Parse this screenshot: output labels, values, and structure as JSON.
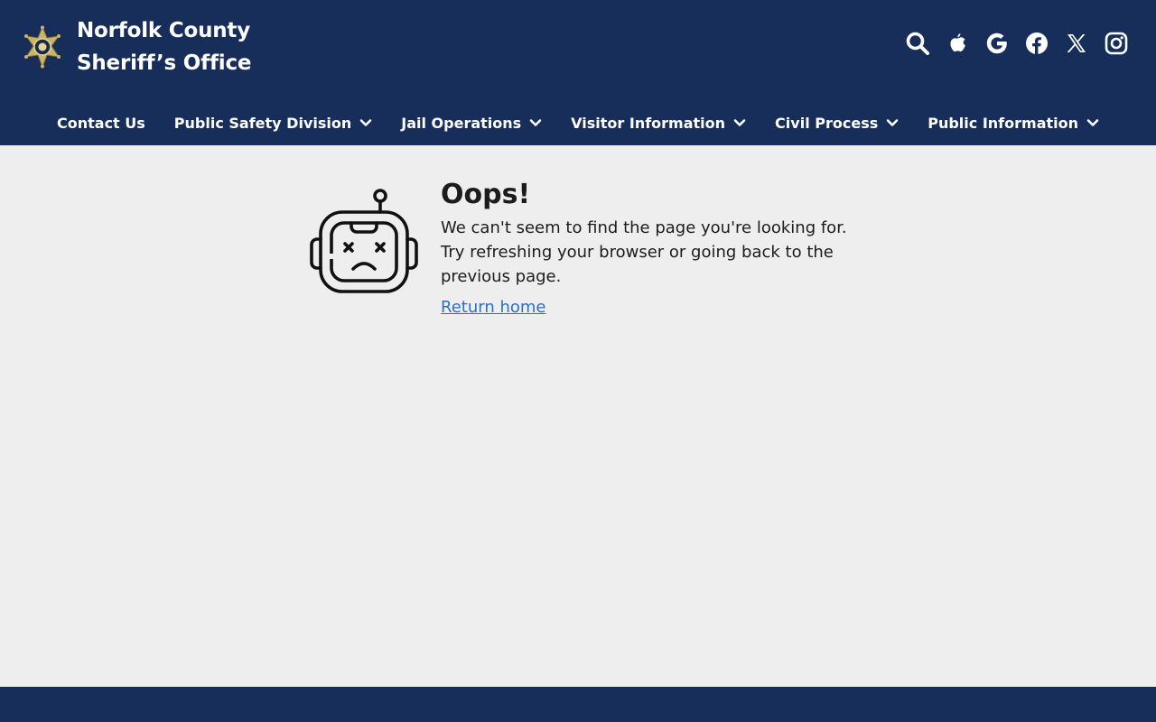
{
  "header": {
    "title_line1": "Norfolk County",
    "title_line2": "Sheriff’s Office",
    "logo_icon": "sheriff-star-badge-icon",
    "background_color": "#172d5a"
  },
  "social": [
    {
      "icon": "search-icon"
    },
    {
      "icon": "apple-icon"
    },
    {
      "icon": "google-icon"
    },
    {
      "icon": "facebook-icon"
    },
    {
      "icon": "x-twitter-icon"
    },
    {
      "icon": "instagram-icon"
    }
  ],
  "nav": {
    "items": [
      {
        "label": "Contact Us"
      },
      {
        "label": "Public Safety Division"
      },
      {
        "label": "Jail Operations"
      },
      {
        "label": "Visitor Information"
      },
      {
        "label": "Civil Process"
      },
      {
        "label": "Public Information"
      }
    ]
  },
  "error": {
    "title": "Oops!",
    "message": "We can't seem to find the page you're looking for. Try refreshing your browser or going back to the previous page.",
    "link_label": "Return home",
    "illustration_icon": "sad-robot-icon",
    "link_color": "#2f6fc4"
  }
}
